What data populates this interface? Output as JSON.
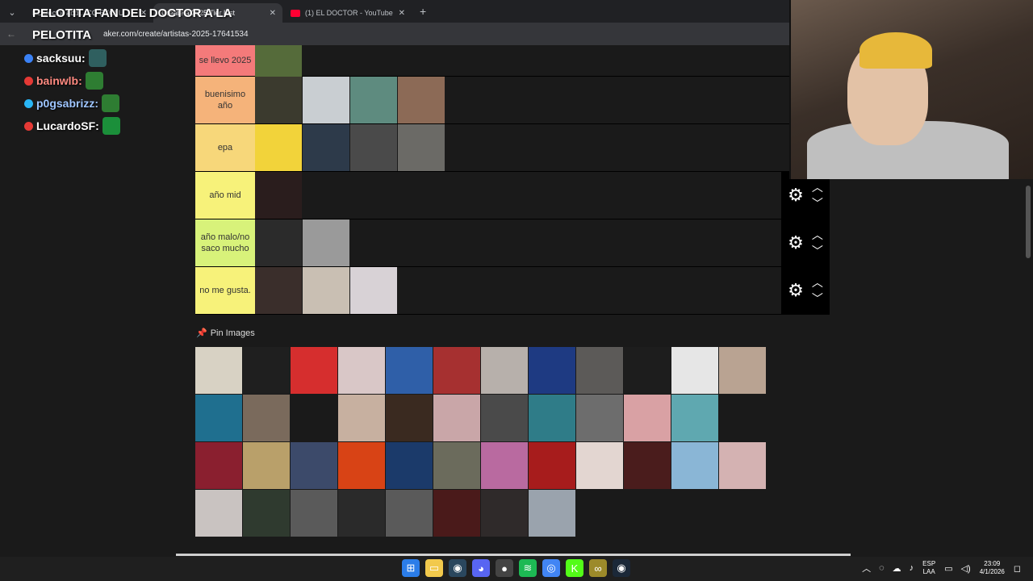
{
  "browser": {
    "tabs": [
      {
        "label": "EL Doctor abd... CO EXCLU"
      },
      {
        "label": "Create a 2025 Tier List"
      },
      {
        "label": "(1) EL DOCTOR - YouTube"
      }
    ],
    "url": "aker.com/create/artistas-2025-17641534"
  },
  "chat": {
    "top_lines": [
      "PELOTITA FAN DEL DOCTOR A LA",
      "PELOTITA"
    ],
    "messages": [
      {
        "user": "sacksuu:",
        "color": "#ffffff",
        "badge": "#3b82f6"
      },
      {
        "user": "bainwlb:",
        "color": "#ff8a80",
        "badge": "#e53935"
      },
      {
        "user": "p0gsabrizz:",
        "color": "#9ec5ff",
        "badge": "#29b6f6"
      },
      {
        "user": "LucardoSF:",
        "color": "#ffffff",
        "badge": "#e53935"
      }
    ]
  },
  "tiers": [
    {
      "label": "se llevo 2025",
      "color": "#f47a7a",
      "items": [
        "#556b3a"
      ]
    },
    {
      "label": "buenisimo año",
      "color": "#f5b37a",
      "items": [
        "#3b3a2e",
        "#c9ced2",
        "#5e8b7f",
        "#8c6a56"
      ]
    },
    {
      "label": "epa",
      "color": "#f7d77a",
      "items": [
        "#f2d33a",
        "#2d3a4a",
        "#4a4a4a",
        "#6b6a66"
      ]
    },
    {
      "label": "año mid",
      "color": "#f7f27a",
      "items": [
        "#2a1d1d"
      ]
    },
    {
      "label": "año malo/no saco mucho",
      "color": "#d8f27a",
      "items": [
        "#2b2b2b",
        "#9a9a9a"
      ]
    },
    {
      "label": "no me gusta.",
      "color": "#f7f27a",
      "items": [
        "#3a2e2b",
        "#c9bfb3",
        "#d8d2d6"
      ]
    }
  ],
  "pool": {
    "label": "Pin Images",
    "items": [
      "#d8d2c4",
      "#1f1f1f",
      "#d62e2e",
      "#d9c7c7",
      "#2f5fa8",
      "#a63030",
      "#b7b0ab",
      "#1e3a82",
      "#5c5a58",
      "#1d1d1d",
      "#e6e6e6",
      "#b9a392",
      "#1f6f8f",
      "#7a6a5c",
      "#1a1a1a",
      "#c7b0a0",
      "#3a2a20",
      "#c9a6a8",
      "#4a4a4a",
      "#2f7c88",
      "#6d6d6d",
      "#d9a1a4",
      "#5fa8b0",
      "#1a1a1a",
      "#8a1f2f",
      "#b9a06a",
      "#3c4a6a",
      "#d84315",
      "#1b3a6a",
      "#6b6b5c",
      "#b96aa0",
      "#a71c1c",
      "#e3d6d1",
      "#4a1c1c",
      "#8ab6d6",
      "#d4b2b2",
      "#c9c3c1",
      "#2f3a2f",
      "#5a5a5a",
      "#2a2a2a",
      "#5a5a5a",
      "#4a1a1a",
      "#2f2a2a",
      "#9aa3ad"
    ]
  },
  "taskbar": {
    "lang": "ESP",
    "lang2": "LAA",
    "time": "23:09",
    "date": "4/1/2026"
  }
}
